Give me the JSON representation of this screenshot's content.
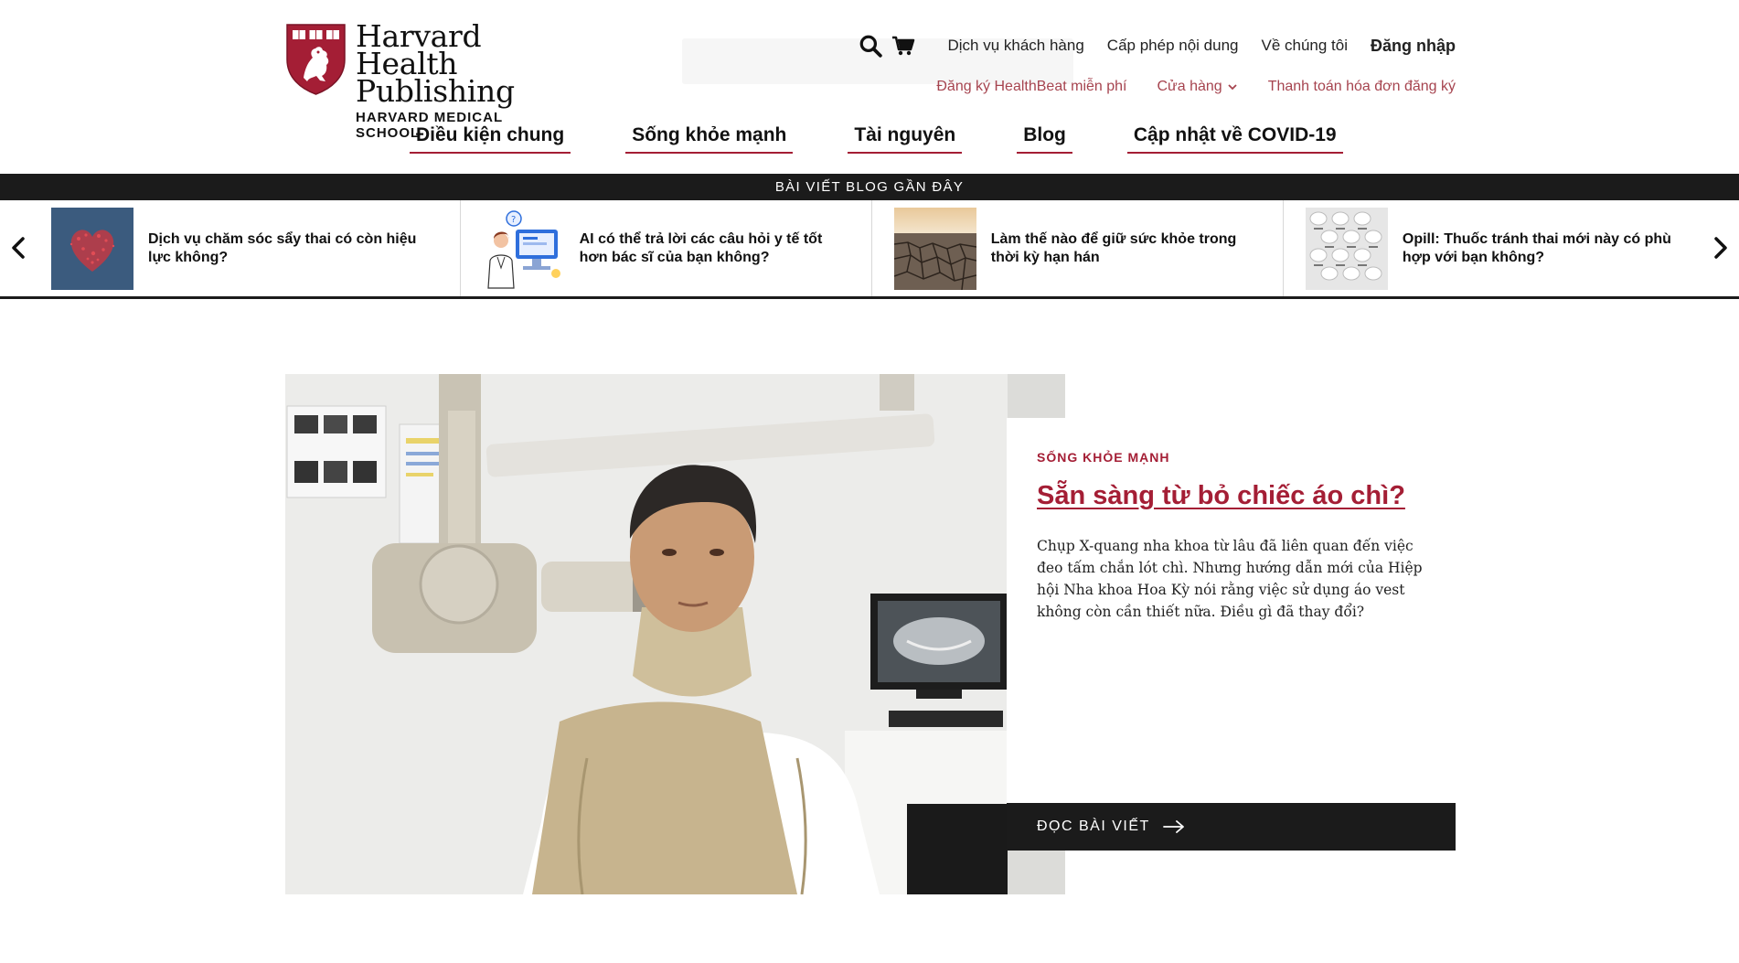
{
  "brand": {
    "title_line1": "Harvard Health",
    "title_line2": "Publishing",
    "subtitle": "HARVARD MEDICAL SCHOOL",
    "shield_color": "#a41e35"
  },
  "utility_nav": {
    "customer_service": "Dịch vụ khách hàng",
    "content_licensing": "Cấp phép nội dung",
    "about_us": "Về chúng tôi",
    "login": "Đăng nhập"
  },
  "secondary_nav": {
    "healthbeat_signup": "Đăng ký HealthBeat miễn phí",
    "store": "Cửa hàng",
    "subscription_billing": "Thanh toán hóa đơn đăng ký"
  },
  "main_nav": [
    {
      "label": "Điều kiện chung"
    },
    {
      "label": "Sống khỏe mạnh"
    },
    {
      "label": "Tài nguyên"
    },
    {
      "label": "Blog"
    },
    {
      "label": "Cập nhật về COVID-19"
    }
  ],
  "blog_strip": {
    "heading": "BÀI VIẾT BLOG GẦN ĐÂY",
    "cards": [
      {
        "title": "Dịch vụ chăm sóc sẩy thai có còn hiệu lực không?",
        "thumb": "heart-dots-image"
      },
      {
        "title": "AI có thể trả lời các câu hỏi y tế tốt hơn bác sĩ của bạn không?",
        "thumb": "ai-doctor-illustration"
      },
      {
        "title": "Làm thế nào để giữ sức khỏe trong thời kỳ hạn hán",
        "thumb": "cracked-earth-image"
      },
      {
        "title": "Opill: Thuốc tránh thai mới này có phù hợp với bạn không?",
        "thumb": "pill-pack-image"
      }
    ]
  },
  "feature": {
    "kicker": "SỐNG KHỎE MẠNH",
    "title": "Sẵn sàng từ bỏ chiếc áo chì?",
    "description": "Chụp X-quang nha khoa từ lâu đã liên quan đến việc đeo tấm chắn lót chì. Nhưng hướng dẫn mới của Hiệp hội Nha khoa Hoa Kỳ nói rằng việc sử dụng áo vest không còn cần thiết nữa. Điều gì đã thay đổi?",
    "button_label": "ĐỌC BÀI VIẾT",
    "accent": "#a41e35"
  }
}
